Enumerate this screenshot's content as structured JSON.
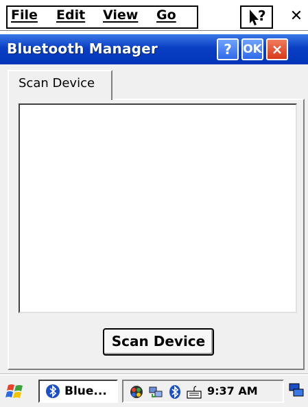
{
  "menubar": {
    "items": [
      "File",
      "Edit",
      "View",
      "Go"
    ]
  },
  "window": {
    "title": "Bluetooth Manager",
    "help_button": "?",
    "ok_button": "OK",
    "close_button": "×"
  },
  "tabs": [
    {
      "label": "Scan Device",
      "selected": true
    }
  ],
  "scan_button": "Scan Device",
  "taskbar": {
    "task_label": "Blue...",
    "time": "9:37 AM"
  },
  "colors": {
    "titlebar": "#0a3fc4",
    "close_red": "#d83a1a"
  }
}
